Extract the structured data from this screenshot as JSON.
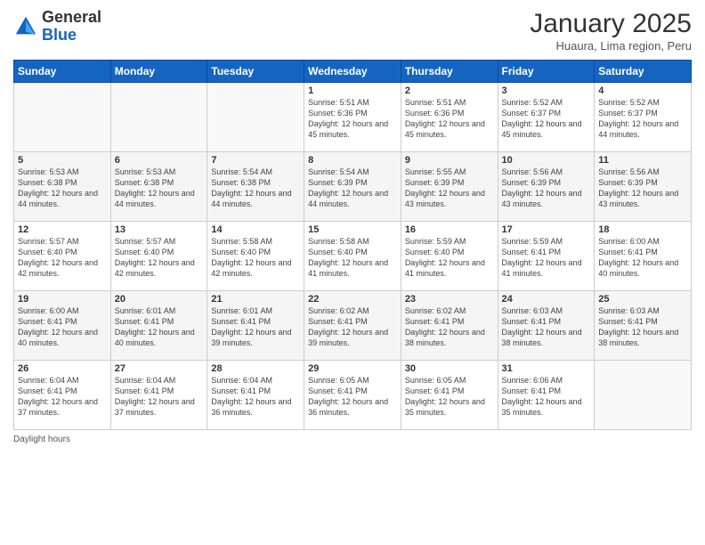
{
  "header": {
    "logo_general": "General",
    "logo_blue": "Blue",
    "title": "January 2025",
    "subtitle": "Huaura, Lima region, Peru"
  },
  "days_of_week": [
    "Sunday",
    "Monday",
    "Tuesday",
    "Wednesday",
    "Thursday",
    "Friday",
    "Saturday"
  ],
  "weeks": [
    [
      {
        "day": "",
        "text": ""
      },
      {
        "day": "",
        "text": ""
      },
      {
        "day": "",
        "text": ""
      },
      {
        "day": "1",
        "text": "Sunrise: 5:51 AM\nSunset: 6:36 PM\nDaylight: 12 hours and 45 minutes."
      },
      {
        "day": "2",
        "text": "Sunrise: 5:51 AM\nSunset: 6:36 PM\nDaylight: 12 hours and 45 minutes."
      },
      {
        "day": "3",
        "text": "Sunrise: 5:52 AM\nSunset: 6:37 PM\nDaylight: 12 hours and 45 minutes."
      },
      {
        "day": "4",
        "text": "Sunrise: 5:52 AM\nSunset: 6:37 PM\nDaylight: 12 hours and 44 minutes."
      }
    ],
    [
      {
        "day": "5",
        "text": "Sunrise: 5:53 AM\nSunset: 6:38 PM\nDaylight: 12 hours and 44 minutes."
      },
      {
        "day": "6",
        "text": "Sunrise: 5:53 AM\nSunset: 6:38 PM\nDaylight: 12 hours and 44 minutes."
      },
      {
        "day": "7",
        "text": "Sunrise: 5:54 AM\nSunset: 6:38 PM\nDaylight: 12 hours and 44 minutes."
      },
      {
        "day": "8",
        "text": "Sunrise: 5:54 AM\nSunset: 6:39 PM\nDaylight: 12 hours and 44 minutes."
      },
      {
        "day": "9",
        "text": "Sunrise: 5:55 AM\nSunset: 6:39 PM\nDaylight: 12 hours and 43 minutes."
      },
      {
        "day": "10",
        "text": "Sunrise: 5:56 AM\nSunset: 6:39 PM\nDaylight: 12 hours and 43 minutes."
      },
      {
        "day": "11",
        "text": "Sunrise: 5:56 AM\nSunset: 6:39 PM\nDaylight: 12 hours and 43 minutes."
      }
    ],
    [
      {
        "day": "12",
        "text": "Sunrise: 5:57 AM\nSunset: 6:40 PM\nDaylight: 12 hours and 42 minutes."
      },
      {
        "day": "13",
        "text": "Sunrise: 5:57 AM\nSunset: 6:40 PM\nDaylight: 12 hours and 42 minutes."
      },
      {
        "day": "14",
        "text": "Sunrise: 5:58 AM\nSunset: 6:40 PM\nDaylight: 12 hours and 42 minutes."
      },
      {
        "day": "15",
        "text": "Sunrise: 5:58 AM\nSunset: 6:40 PM\nDaylight: 12 hours and 41 minutes."
      },
      {
        "day": "16",
        "text": "Sunrise: 5:59 AM\nSunset: 6:40 PM\nDaylight: 12 hours and 41 minutes."
      },
      {
        "day": "17",
        "text": "Sunrise: 5:59 AM\nSunset: 6:41 PM\nDaylight: 12 hours and 41 minutes."
      },
      {
        "day": "18",
        "text": "Sunrise: 6:00 AM\nSunset: 6:41 PM\nDaylight: 12 hours and 40 minutes."
      }
    ],
    [
      {
        "day": "19",
        "text": "Sunrise: 6:00 AM\nSunset: 6:41 PM\nDaylight: 12 hours and 40 minutes."
      },
      {
        "day": "20",
        "text": "Sunrise: 6:01 AM\nSunset: 6:41 PM\nDaylight: 12 hours and 40 minutes."
      },
      {
        "day": "21",
        "text": "Sunrise: 6:01 AM\nSunset: 6:41 PM\nDaylight: 12 hours and 39 minutes."
      },
      {
        "day": "22",
        "text": "Sunrise: 6:02 AM\nSunset: 6:41 PM\nDaylight: 12 hours and 39 minutes."
      },
      {
        "day": "23",
        "text": "Sunrise: 6:02 AM\nSunset: 6:41 PM\nDaylight: 12 hours and 38 minutes."
      },
      {
        "day": "24",
        "text": "Sunrise: 6:03 AM\nSunset: 6:41 PM\nDaylight: 12 hours and 38 minutes."
      },
      {
        "day": "25",
        "text": "Sunrise: 6:03 AM\nSunset: 6:41 PM\nDaylight: 12 hours and 38 minutes."
      }
    ],
    [
      {
        "day": "26",
        "text": "Sunrise: 6:04 AM\nSunset: 6:41 PM\nDaylight: 12 hours and 37 minutes."
      },
      {
        "day": "27",
        "text": "Sunrise: 6:04 AM\nSunset: 6:41 PM\nDaylight: 12 hours and 37 minutes."
      },
      {
        "day": "28",
        "text": "Sunrise: 6:04 AM\nSunset: 6:41 PM\nDaylight: 12 hours and 36 minutes."
      },
      {
        "day": "29",
        "text": "Sunrise: 6:05 AM\nSunset: 6:41 PM\nDaylight: 12 hours and 36 minutes."
      },
      {
        "day": "30",
        "text": "Sunrise: 6:05 AM\nSunset: 6:41 PM\nDaylight: 12 hours and 35 minutes."
      },
      {
        "day": "31",
        "text": "Sunrise: 6:06 AM\nSunset: 6:41 PM\nDaylight: 12 hours and 35 minutes."
      },
      {
        "day": "",
        "text": ""
      }
    ]
  ],
  "footer": {
    "daylight_label": "Daylight hours"
  }
}
